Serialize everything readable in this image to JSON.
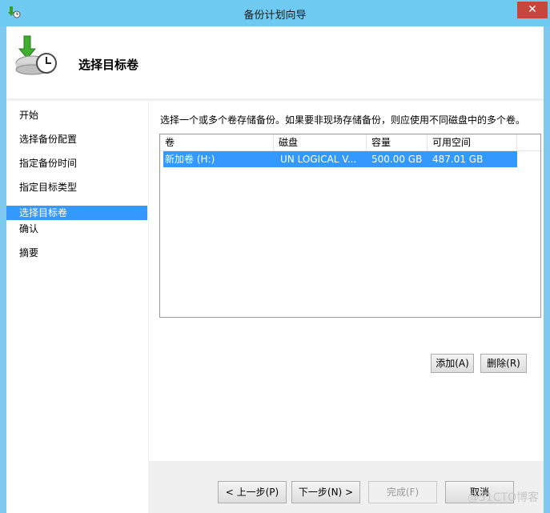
{
  "window": {
    "title": "备份计划向导",
    "close_glyph": "✕"
  },
  "header": {
    "title": "选择目标卷"
  },
  "nav": {
    "items": [
      {
        "label": "开始"
      },
      {
        "label": "选择备份配置"
      },
      {
        "label": "指定备份时间"
      },
      {
        "label": "指定目标类型"
      },
      {
        "label": "选择目标卷",
        "active": true
      },
      {
        "label": "确认"
      },
      {
        "label": "摘要"
      }
    ]
  },
  "content": {
    "instruction": "选择一个或多个卷存储备份。如果要非现场存储备份，则应使用不同磁盘中的多个卷。",
    "table": {
      "columns": [
        "卷",
        "磁盘",
        "容量",
        "可用空间"
      ],
      "rows": [
        {
          "volume": "新加卷 (H:)",
          "disk": "UN LOGICAL V...",
          "capacity": "500.00 GB",
          "free": "487.01 GB",
          "selected": true
        }
      ]
    },
    "add_label": "添加(A)",
    "remove_label": "删除(R)"
  },
  "footer": {
    "prev_label": "< 上一步(P)",
    "next_label": "下一步(N) >",
    "finish_label": "完成(F)",
    "cancel_label": "取消"
  },
  "watermark": "@51CTO博客",
  "colors": {
    "titlebar": "#6ecaf0",
    "selection": "#3399ff",
    "close": "#c7463b"
  }
}
